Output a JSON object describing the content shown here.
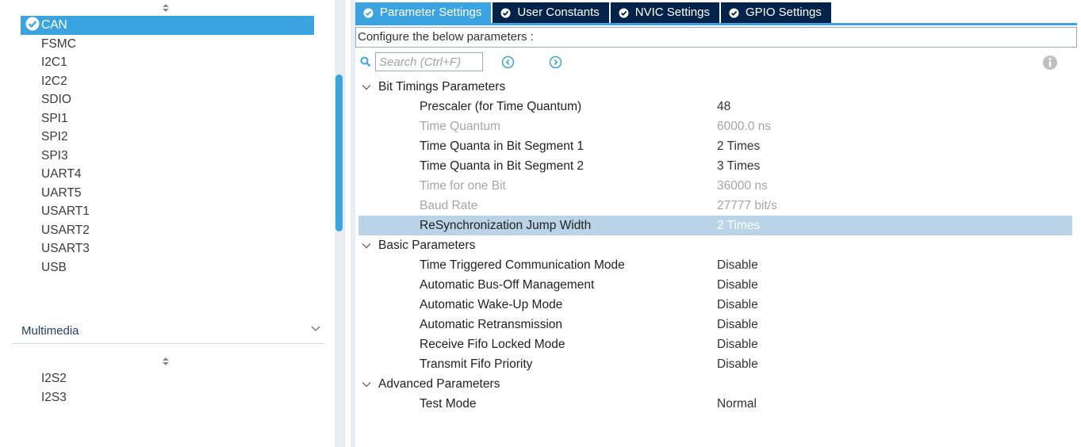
{
  "left_panel": {
    "connectivity_items": [
      {
        "label": "CAN",
        "selected": true
      },
      {
        "label": "FSMC"
      },
      {
        "label": "I2C1"
      },
      {
        "label": "I2C2"
      },
      {
        "label": "SDIO"
      },
      {
        "label": "SPI1"
      },
      {
        "label": "SPI2"
      },
      {
        "label": "SPI3"
      },
      {
        "label": "UART4"
      },
      {
        "label": "UART5"
      },
      {
        "label": "USART1"
      },
      {
        "label": "USART2"
      },
      {
        "label": "USART3"
      },
      {
        "label": "USB"
      }
    ],
    "multimedia": {
      "title": "Multimedia",
      "items": [
        "I2S2",
        "I2S3"
      ]
    }
  },
  "tabs": [
    {
      "label": "Parameter Settings",
      "active": true
    },
    {
      "label": "User Constants"
    },
    {
      "label": "NVIC Settings"
    },
    {
      "label": "GPIO Settings"
    }
  ],
  "config_label": "Configure the below parameters :",
  "search": {
    "placeholder": "Search (Ctrl+F)"
  },
  "icons": {
    "search": "search-icon",
    "prev": "prev-circle-icon",
    "next": "next-circle-icon",
    "info": "info-icon",
    "check": "check-circle-icon"
  },
  "colors": {
    "accent": "#3ba3e0",
    "tab_bg": "#03234b",
    "selected_row": "#bad3e6"
  },
  "groups": [
    {
      "title": "Bit Timings Parameters",
      "params": [
        {
          "name": "Prescaler (for Time Quantum)",
          "value": "48"
        },
        {
          "name": "Time Quantum",
          "value": "6000.0 ns",
          "disabled": true
        },
        {
          "name": "Time Quanta in Bit Segment 1",
          "value": "2 Times"
        },
        {
          "name": "Time Quanta in Bit Segment 2",
          "value": "3 Times"
        },
        {
          "name": "Time for one Bit",
          "value": "36000 ns",
          "disabled": true
        },
        {
          "name": "Baud Rate",
          "value": "27777 bit/s",
          "disabled": true
        },
        {
          "name": "ReSynchronization Jump Width",
          "value": "2 Times",
          "selected": true
        }
      ]
    },
    {
      "title": "Basic Parameters",
      "params": [
        {
          "name": "Time Triggered Communication Mode",
          "value": "Disable"
        },
        {
          "name": "Automatic Bus-Off Management",
          "value": "Disable"
        },
        {
          "name": "Automatic Wake-Up Mode",
          "value": "Disable"
        },
        {
          "name": "Automatic Retransmission",
          "value": "Disable"
        },
        {
          "name": "Receive Fifo Locked Mode",
          "value": "Disable"
        },
        {
          "name": "Transmit Fifo Priority",
          "value": "Disable"
        }
      ]
    },
    {
      "title": "Advanced Parameters",
      "params": [
        {
          "name": "Test Mode",
          "value": "Normal"
        }
      ]
    }
  ]
}
